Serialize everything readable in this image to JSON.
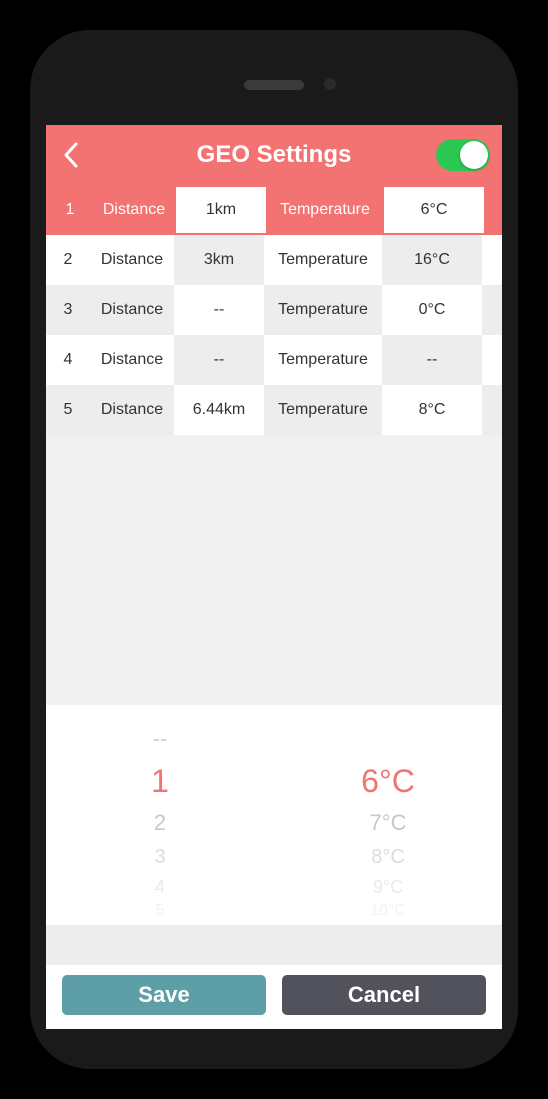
{
  "header": {
    "title": "GEO Settings",
    "toggle_on": true
  },
  "labels": {
    "distance": "Distance",
    "temperature": "Temperature"
  },
  "rows": [
    {
      "num": "1",
      "distance": "1km",
      "temperature": "6°C",
      "selected": true
    },
    {
      "num": "2",
      "distance": "3km",
      "temperature": "16°C",
      "selected": false
    },
    {
      "num": "3",
      "distance": "--",
      "temperature": "0°C",
      "selected": false
    },
    {
      "num": "4",
      "distance": "--",
      "temperature": "--",
      "selected": false
    },
    {
      "num": "5",
      "distance": "6.44km",
      "temperature": "8°C",
      "selected": false
    }
  ],
  "picker": {
    "col1": {
      "above": "--",
      "selected": "1",
      "below": [
        "2",
        "3",
        "4",
        "5"
      ]
    },
    "col2": {
      "above": "",
      "selected": "6°C",
      "below": [
        "7°C",
        "8°C",
        "9°C",
        "10°C"
      ]
    }
  },
  "buttons": {
    "save": "Save",
    "cancel": "Cancel"
  }
}
